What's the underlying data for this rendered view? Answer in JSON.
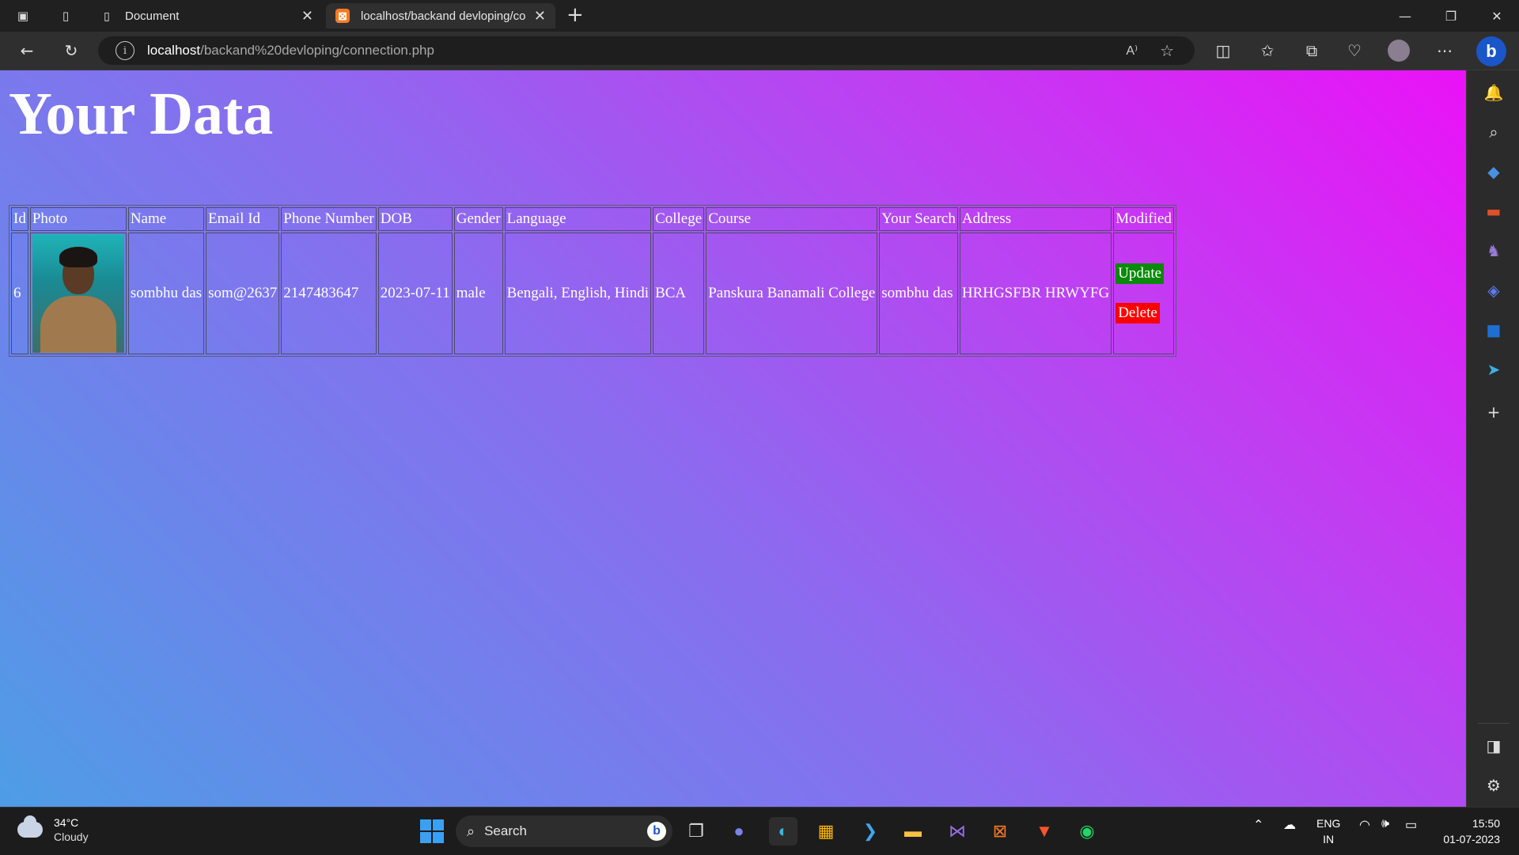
{
  "browser": {
    "tabs": [
      {
        "title": "Document",
        "icon": "document-icon",
        "active": false
      },
      {
        "title": "localhost/backand devloping/co",
        "icon": "xampp-icon",
        "active": true
      }
    ],
    "address": {
      "host": "localhost",
      "path": "/backand%20devloping/connection.php"
    }
  },
  "page": {
    "heading": "Your Data",
    "table": {
      "headers": [
        "Id",
        "Photo",
        "Name",
        "Email Id",
        "Phone Number",
        "DOB",
        "Gender",
        "Language",
        "College",
        "Course",
        "Your Search",
        "Address",
        "Modified"
      ],
      "row": {
        "id": "6",
        "name": "sombhu das",
        "email": "som@2637",
        "phone": "2147483647",
        "dob": "2023-07-11",
        "gender": "male",
        "language": "Bengali, English, Hindi",
        "college": "BCA",
        "course": "Panskura Banamali College",
        "search": "sombhu das",
        "address": "HRHGSFBR HRWYFG",
        "update_label": "Update",
        "delete_label": "Delete"
      }
    }
  },
  "taskbar": {
    "weather_temp": "34°C",
    "weather_desc": "Cloudy",
    "search_label": "Search",
    "lang_line1": "ENG",
    "lang_line2": "IN",
    "time": "15:50",
    "date": "01-07-2023"
  },
  "colors": {
    "update_bg": "#0a8a0a",
    "delete_bg": "#ff0000",
    "gradient_start": "#4e9de6",
    "gradient_end": "#ea12f7"
  }
}
